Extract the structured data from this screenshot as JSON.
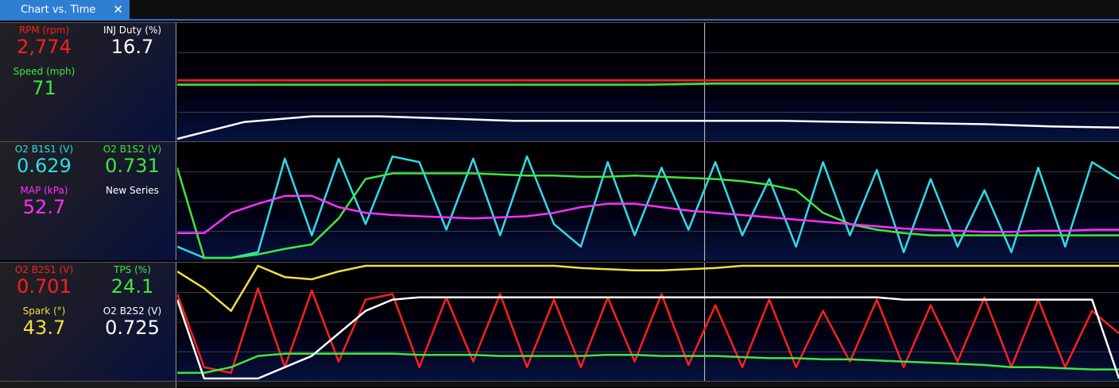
{
  "tab": {
    "title": "Chart vs. Time",
    "close_glyph": "✕"
  },
  "panels": [
    {
      "channels": [
        {
          "label": "RPM (rpm)",
          "value": "2,774",
          "color": "#ff1f1f"
        },
        {
          "label": "INJ Duty (%)",
          "value": "16.7",
          "color": "#ffffff"
        },
        {
          "label": "Speed (mph)",
          "value": "71",
          "color": "#3ee83e"
        },
        {
          "label": "",
          "value": "",
          "color": "#ffffff"
        }
      ]
    },
    {
      "channels": [
        {
          "label": "O2 B1S1 (V)",
          "value": "0.629",
          "color": "#30dce8"
        },
        {
          "label": "O2 B1S2 (V)",
          "value": "0.731",
          "color": "#3ee83e"
        },
        {
          "label": "MAP (kPa)",
          "value": "52.7",
          "color": "#ff30ff"
        },
        {
          "label": "New Series",
          "value": "",
          "color": "#ffffff"
        }
      ]
    },
    {
      "channels": [
        {
          "label": "O2 B2S1 (V)",
          "value": "0.701",
          "color": "#ff1f1f"
        },
        {
          "label": "TPS (%)",
          "value": "24.1",
          "color": "#3ee83e"
        },
        {
          "label": "Spark (°)",
          "value": "43.7",
          "color": "#f0e040"
        },
        {
          "label": "O2 B2S2 (V)",
          "value": "0.725",
          "color": "#ffffff"
        }
      ]
    }
  ],
  "chart_data": [
    {
      "type": "line",
      "title": "",
      "x": [
        0,
        10,
        20,
        30,
        40,
        50,
        60,
        70,
        80,
        90,
        100,
        110,
        120,
        130,
        140
      ],
      "ylim": [
        0,
        100
      ],
      "grid": true,
      "series": [
        {
          "name": "RPM (rpm)",
          "color": "#ff1f1f",
          "values": [
            52,
            52,
            52,
            52,
            52,
            52,
            52,
            52,
            52,
            52,
            52,
            52,
            52,
            52,
            52
          ]
        },
        {
          "name": "Speed (mph)",
          "color": "#3ee83e",
          "values": [
            48,
            48,
            48,
            48,
            48,
            48,
            48,
            48,
            49,
            49,
            49,
            49,
            49,
            49,
            49
          ]
        },
        {
          "name": "INJ Duty (%)",
          "color": "#ffffff",
          "values": [
            0,
            15,
            20,
            20,
            18,
            16,
            16,
            16,
            16,
            16,
            15,
            14,
            13,
            11,
            10
          ]
        }
      ]
    },
    {
      "type": "line",
      "title": "",
      "x": [
        0,
        4,
        8,
        12,
        16,
        20,
        24,
        28,
        32,
        36,
        40,
        44,
        48,
        52,
        56,
        60,
        64,
        68,
        72,
        76,
        80,
        84,
        88,
        92,
        96,
        100,
        104,
        108,
        112,
        116,
        120,
        124,
        128,
        132,
        136,
        140
      ],
      "ylim": [
        0,
        100
      ],
      "grid": true,
      "series": [
        {
          "name": "O2 B1S1 (V)",
          "color": "#30dce8",
          "values": [
            10,
            0,
            0,
            5,
            88,
            20,
            88,
            30,
            90,
            85,
            25,
            88,
            20,
            90,
            30,
            10,
            85,
            20,
            80,
            25,
            85,
            20,
            70,
            10,
            85,
            20,
            78,
            5,
            70,
            10,
            60,
            5,
            80,
            10,
            85,
            70
          ]
        },
        {
          "name": "O2 B1S2 (V)",
          "color": "#3ee83e",
          "values": [
            80,
            0,
            0,
            3,
            8,
            12,
            35,
            70,
            75,
            75,
            75,
            75,
            74,
            73,
            73,
            72,
            72,
            73,
            72,
            71,
            70,
            68,
            65,
            60,
            40,
            30,
            25,
            22,
            20,
            20,
            20,
            20,
            20,
            20,
            20,
            20
          ]
        },
        {
          "name": "MAP (kPa)",
          "color": "#ff30ff",
          "values": [
            22,
            22,
            40,
            48,
            55,
            55,
            45,
            40,
            38,
            37,
            36,
            35,
            36,
            37,
            40,
            45,
            48,
            48,
            45,
            42,
            40,
            38,
            36,
            34,
            32,
            30,
            28,
            26,
            25,
            24,
            23,
            23,
            24,
            24,
            25,
            25
          ]
        }
      ]
    },
    {
      "type": "line",
      "title": "",
      "x": [
        0,
        4,
        8,
        12,
        16,
        20,
        24,
        28,
        32,
        36,
        40,
        44,
        48,
        52,
        56,
        60,
        64,
        68,
        72,
        76,
        80,
        84,
        88,
        92,
        96,
        100,
        104,
        108,
        112,
        116,
        120,
        124,
        128,
        132,
        136,
        140
      ],
      "ylim": [
        0,
        100
      ],
      "grid": true,
      "series": [
        {
          "name": "O2 B2S1 (V)",
          "color": "#ff1f1f",
          "values": [
            75,
            10,
            5,
            80,
            10,
            78,
            15,
            70,
            75,
            10,
            72,
            15,
            75,
            10,
            70,
            10,
            72,
            15,
            75,
            12,
            65,
            10,
            70,
            10,
            60,
            15,
            70,
            10,
            65,
            15,
            72,
            10,
            70,
            10,
            60,
            40
          ]
        },
        {
          "name": "TPS (%)",
          "color": "#3ee83e",
          "values": [
            5,
            5,
            10,
            20,
            22,
            22,
            22,
            22,
            22,
            21,
            21,
            21,
            20,
            20,
            20,
            20,
            21,
            21,
            20,
            20,
            20,
            19,
            18,
            18,
            17,
            17,
            16,
            15,
            14,
            13,
            12,
            10,
            10,
            9,
            8,
            8
          ]
        },
        {
          "name": "Spark (°)",
          "color": "#f0e040",
          "values": [
            95,
            80,
            60,
            100,
            90,
            88,
            95,
            100,
            100,
            100,
            100,
            100,
            100,
            100,
            100,
            98,
            97,
            96,
            96,
            97,
            98,
            100,
            100,
            100,
            100,
            100,
            100,
            100,
            100,
            100,
            100,
            100,
            100,
            100,
            100,
            100
          ]
        },
        {
          "name": "O2 B2S2 (V)",
          "color": "#ffffff",
          "values": [
            70,
            0,
            0,
            0,
            10,
            20,
            40,
            60,
            70,
            72,
            72,
            72,
            72,
            72,
            72,
            72,
            72,
            72,
            72,
            72,
            72,
            72,
            72,
            72,
            72,
            72,
            72,
            70,
            70,
            70,
            70,
            70,
            70,
            70,
            70,
            0
          ]
        }
      ]
    }
  ]
}
